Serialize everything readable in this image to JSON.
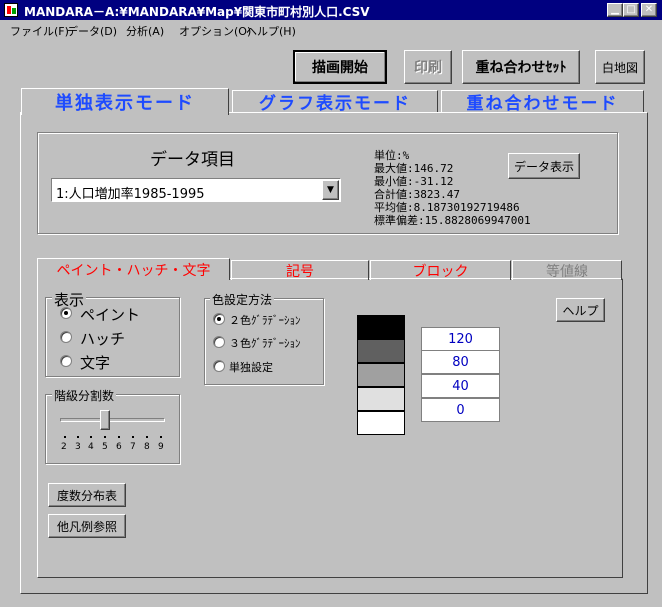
{
  "window": {
    "title": "MANDARA－A:¥MANDARA¥Map¥関東市町村別人口.CSV"
  },
  "menu": [
    {
      "label": "ファイル(F)"
    },
    {
      "label": "データ(D)"
    },
    {
      "label": "分析(A)"
    },
    {
      "label": "オプション(O)"
    },
    {
      "label": "ヘルプ(H)"
    }
  ],
  "toolbar": {
    "draw_label": "描画開始",
    "print_label": "印刷",
    "overlay_set_label": "重ね合わせｾｯﾄ",
    "blank_map_label": "白地図"
  },
  "main_tabs": [
    {
      "label": "単独表示モード"
    },
    {
      "label": "グラフ表示モード"
    },
    {
      "label": "重ね合わせモード"
    }
  ],
  "data_item": {
    "heading": "データ項目",
    "selected": "1:人口増加率1985-1995",
    "show_button": "データ表示"
  },
  "stats": {
    "unit": "単位:%",
    "max": "最大値:146.72",
    "min": "最小値:-31.12",
    "sum": "合計値:3823.47",
    "mean": "平均値:8.18730192719486",
    "std": "標準偏差:15.8828069947001"
  },
  "sub_tabs": [
    {
      "label": "ペイント・ハッチ・文字",
      "color": "#ff0000"
    },
    {
      "label": "記号",
      "color": "#ff0000"
    },
    {
      "label": "ブロック",
      "color": "#ff0000"
    },
    {
      "label": "等値線",
      "color": "#808080"
    }
  ],
  "display": {
    "title": "表示",
    "options": [
      {
        "label": "ペイント",
        "selected": true
      },
      {
        "label": "ハッチ",
        "selected": false
      },
      {
        "label": "文字",
        "selected": false
      }
    ]
  },
  "color_method": {
    "title": "色設定方法",
    "options": [
      {
        "label": "２色ｸﾞﾗﾃﾞｰｼｮﾝ",
        "selected": true
      },
      {
        "label": "３色ｸﾞﾗﾃﾞｰｼｮﾝ",
        "selected": false
      },
      {
        "label": "単独設定",
        "selected": false
      }
    ]
  },
  "classes": {
    "title": "階級分割数",
    "ticks": [
      "2",
      "3",
      "4",
      "5",
      "6",
      "7",
      "8",
      "9"
    ],
    "value": 5
  },
  "legend": {
    "colors": [
      "#000000",
      "#606060",
      "#a0a0a0",
      "#e0e0e0",
      "#ffffff"
    ],
    "values": [
      "120",
      "80",
      "40",
      "0"
    ]
  },
  "help_label": "ヘルプ",
  "freq_table_label": "度数分布表",
  "other_legend_label": "他凡例参照"
}
